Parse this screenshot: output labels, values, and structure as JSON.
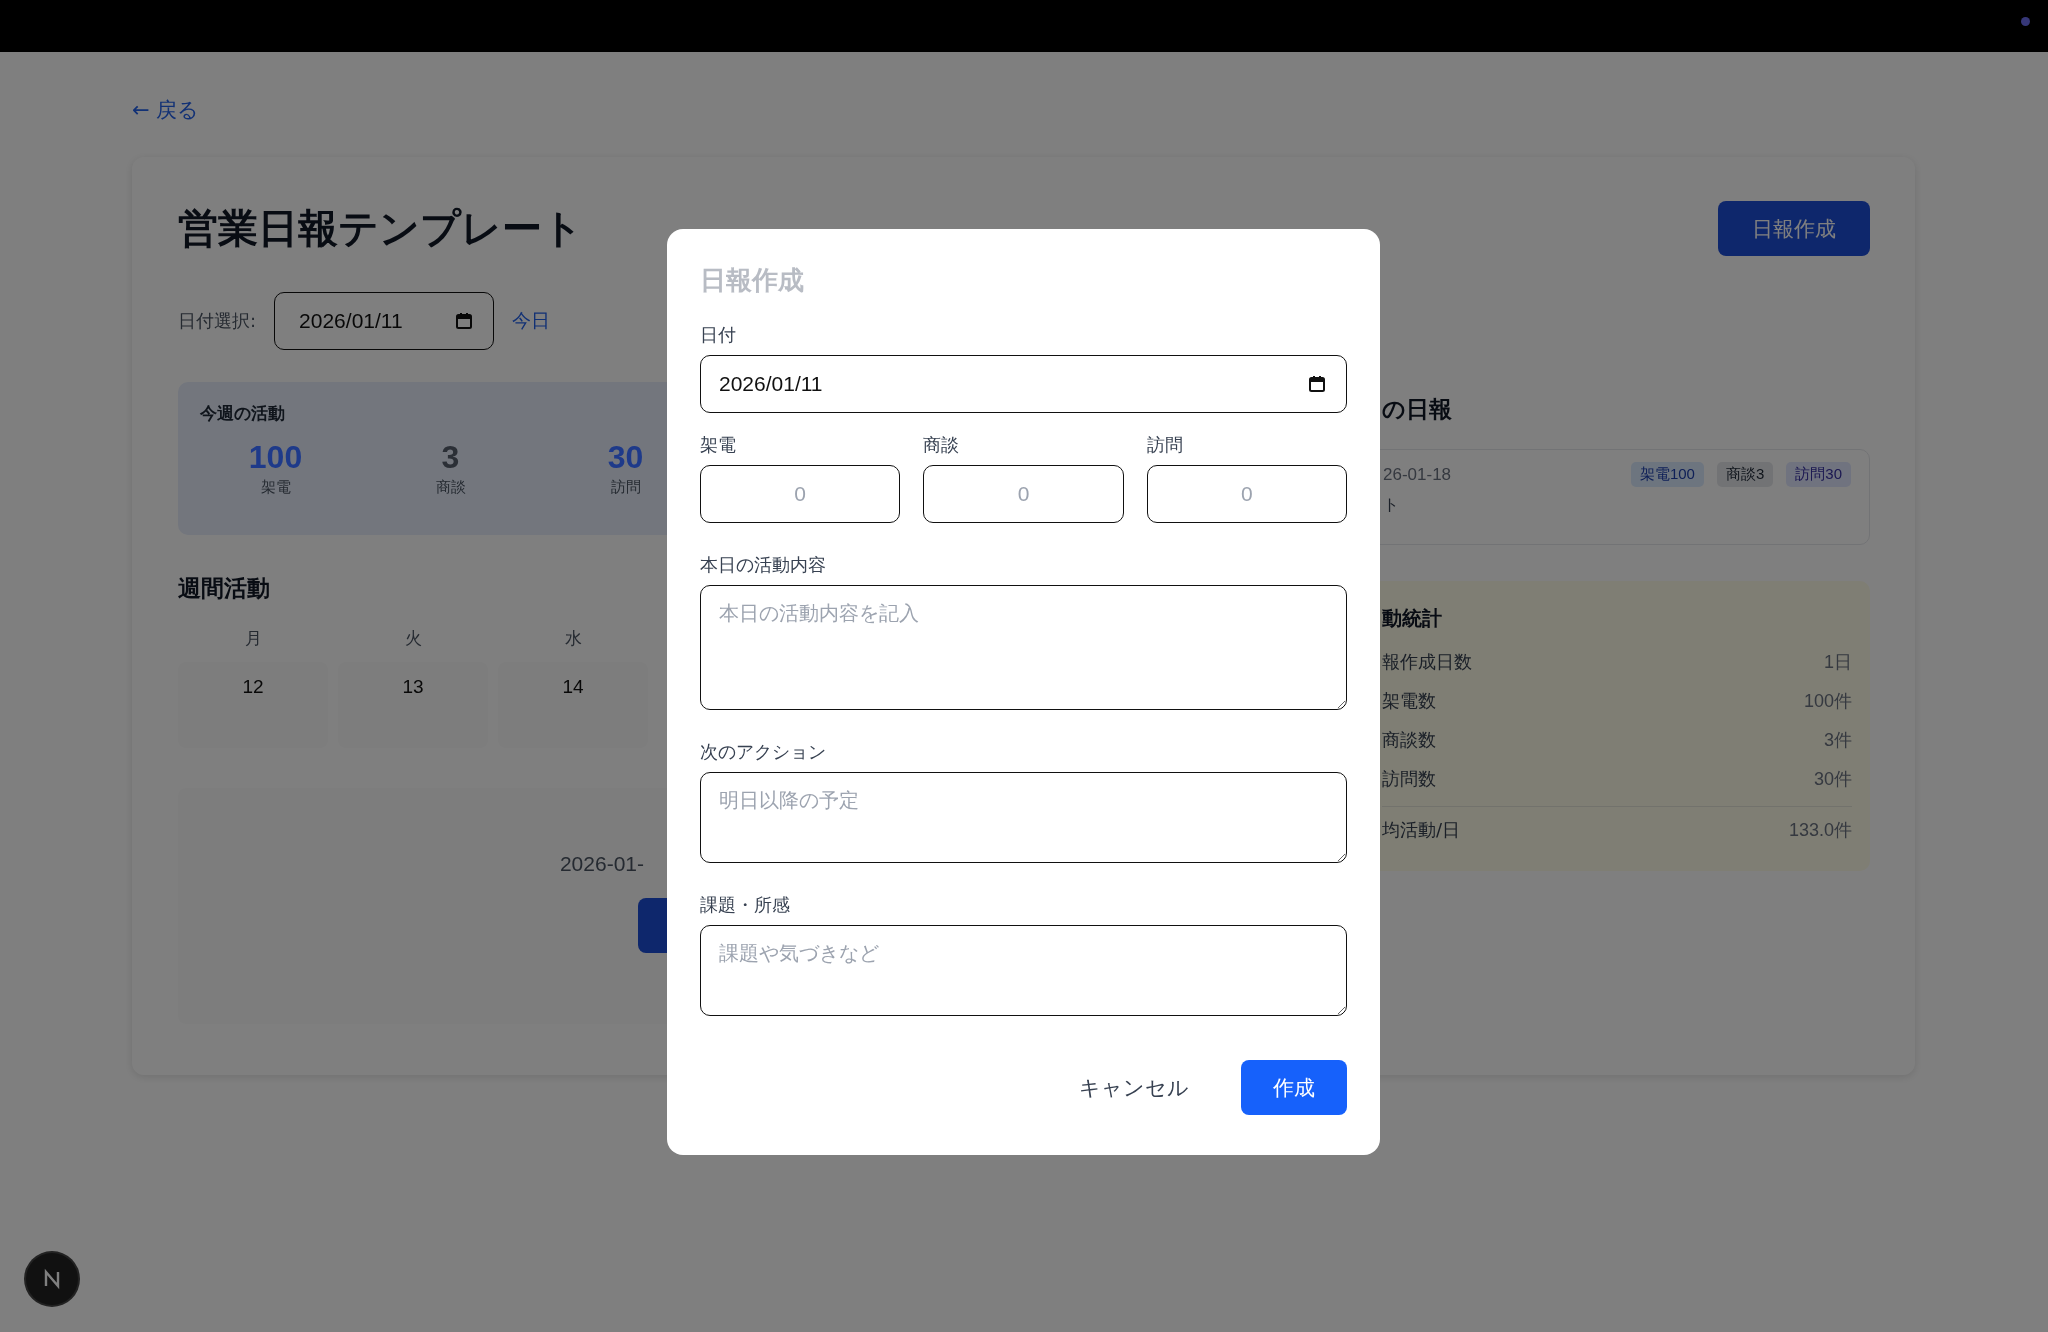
{
  "back_link": "← 戻る",
  "header": {
    "title": "営業日報テンプレート",
    "create_button": "日報作成",
    "date_label": "日付選択:",
    "date_value": "2026/01/11",
    "today_link": "今日"
  },
  "weekly_summary": {
    "title": "今週の活動",
    "stats": [
      {
        "value": "100",
        "label": "架電",
        "color": "#1e3a8a"
      },
      {
        "value": "3",
        "label": "商談",
        "color": "#2b2f36"
      },
      {
        "value": "30",
        "label": "訪問",
        "color": "#1e3a8a"
      }
    ]
  },
  "weekly_activity": {
    "title": "週間活動",
    "days": [
      {
        "weekday": "月",
        "date": "12"
      },
      {
        "weekday": "火",
        "date": "13"
      },
      {
        "weekday": "水",
        "date": "14"
      }
    ]
  },
  "report_list": {
    "date_text": "2026-01-"
  },
  "recent_reports": {
    "title": "の日報",
    "items": [
      {
        "date": "26-01-18",
        "note": "ト",
        "tags": [
          {
            "label": "架電100",
            "kind": "call"
          },
          {
            "label": "商談3",
            "kind": "meeting"
          },
          {
            "label": "訪問30",
            "kind": "visit"
          }
        ]
      }
    ]
  },
  "activity_stats": {
    "title": "動統計",
    "rows": [
      {
        "label": "報作成日数",
        "value": "1日"
      },
      {
        "label": "架電数",
        "value": "100件"
      },
      {
        "label": "商談数",
        "value": "3件"
      },
      {
        "label": "訪問数",
        "value": "30件"
      }
    ],
    "summary": {
      "label": "均活動/日",
      "value": "133.0件"
    }
  },
  "dialog": {
    "title": "日報作成",
    "date": {
      "label": "日付",
      "value": "2026/01/11"
    },
    "counts": [
      {
        "label": "架電",
        "placeholder": "0"
      },
      {
        "label": "商談",
        "placeholder": "0"
      },
      {
        "label": "訪問",
        "placeholder": "0"
      }
    ],
    "text_areas": [
      {
        "label": "本日の活動内容",
        "placeholder": "本日の活動内容を記入"
      },
      {
        "label": "次のアクション",
        "placeholder": "明日以降の予定"
      },
      {
        "label": "課題・所感",
        "placeholder": "課題や気づきなど"
      }
    ],
    "buttons": [
      {
        "label": "キャンセル",
        "kind": "secondary"
      },
      {
        "label": "作成",
        "kind": "primary"
      }
    ]
  }
}
